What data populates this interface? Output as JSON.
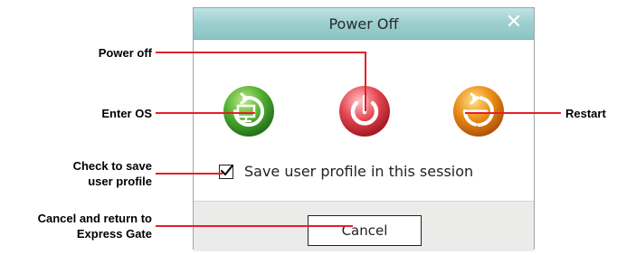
{
  "dialog": {
    "title": "Power Off",
    "close_icon": "close-icon",
    "buttons": [
      {
        "name": "enter-os-button",
        "icon": "monitor-icon",
        "color": "#4fae2d"
      },
      {
        "name": "power-off-button",
        "icon": "power-icon",
        "color": "#e2464f"
      },
      {
        "name": "restart-button",
        "icon": "restart-icon",
        "color": "#e98a14"
      }
    ],
    "checkbox_label": "Save user profile in this session",
    "checkbox_checked": true,
    "cancel_label": "Cancel"
  },
  "callouts": {
    "power_off": "Power off",
    "enter_os": "Enter OS",
    "restart": "Restart",
    "save_profile_line1": "Check to save",
    "save_profile_line2": "user profile",
    "cancel_line1": "Cancel and return to",
    "cancel_line2": "Express Gate"
  },
  "colors": {
    "leader_line": "#e2202a",
    "titlebar": "#9ccfcf"
  }
}
